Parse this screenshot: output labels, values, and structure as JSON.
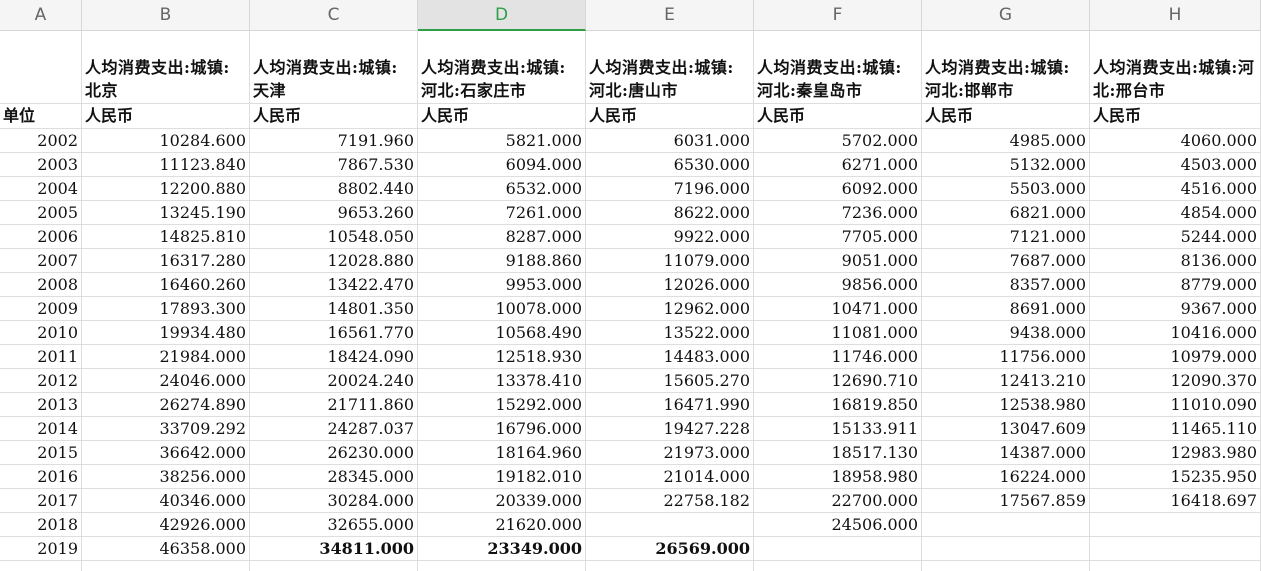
{
  "columns": [
    "A",
    "B",
    "C",
    "D",
    "E",
    "F",
    "G",
    "H"
  ],
  "selected_column": "D",
  "headers": [
    "",
    "人均消费支出:城镇:北京",
    "人均消费支出:城镇:天津",
    "人均消费支出:城镇:河北:石家庄市",
    "人均消费支出:城镇:河北:唐山市",
    "人均消费支出:城镇:河北:秦皇岛市",
    "人均消费支出:城镇:河北:邯郸市",
    "人均消费支出:城镇:河北:邢台市"
  ],
  "units": [
    "单位",
    "人民币",
    "人民币",
    "人民币",
    "人民币",
    "人民币",
    "人民币",
    "人民币"
  ],
  "rows": [
    [
      "2002",
      "10284.600",
      "7191.960",
      "5821.000",
      "6031.000",
      "5702.000",
      "4985.000",
      "4060.000"
    ],
    [
      "2003",
      "11123.840",
      "7867.530",
      "6094.000",
      "6530.000",
      "6271.000",
      "5132.000",
      "4503.000"
    ],
    [
      "2004",
      "12200.880",
      "8802.440",
      "6532.000",
      "7196.000",
      "6092.000",
      "5503.000",
      "4516.000"
    ],
    [
      "2005",
      "13245.190",
      "9653.260",
      "7261.000",
      "8622.000",
      "7236.000",
      "6821.000",
      "4854.000"
    ],
    [
      "2006",
      "14825.810",
      "10548.050",
      "8287.000",
      "9922.000",
      "7705.000",
      "7121.000",
      "5244.000"
    ],
    [
      "2007",
      "16317.280",
      "12028.880",
      "9188.860",
      "11079.000",
      "9051.000",
      "7687.000",
      "8136.000"
    ],
    [
      "2008",
      "16460.260",
      "13422.470",
      "9953.000",
      "12026.000",
      "9856.000",
      "8357.000",
      "8779.000"
    ],
    [
      "2009",
      "17893.300",
      "14801.350",
      "10078.000",
      "12962.000",
      "10471.000",
      "8691.000",
      "9367.000"
    ],
    [
      "2010",
      "19934.480",
      "16561.770",
      "10568.490",
      "13522.000",
      "11081.000",
      "9438.000",
      "10416.000"
    ],
    [
      "2011",
      "21984.000",
      "18424.090",
      "12518.930",
      "14483.000",
      "11746.000",
      "11756.000",
      "10979.000"
    ],
    [
      "2012",
      "24046.000",
      "20024.240",
      "13378.410",
      "15605.270",
      "12690.710",
      "12413.210",
      "12090.370"
    ],
    [
      "2013",
      "26274.890",
      "21711.860",
      "15292.000",
      "16471.990",
      "16819.850",
      "12538.980",
      "11010.090"
    ],
    [
      "2014",
      "33709.292",
      "24287.037",
      "16796.000",
      "19427.228",
      "15133.911",
      "13047.609",
      "11465.110"
    ],
    [
      "2015",
      "36642.000",
      "26230.000",
      "18164.960",
      "21973.000",
      "18517.130",
      "14387.000",
      "12983.980"
    ],
    [
      "2016",
      "38256.000",
      "28345.000",
      "19182.010",
      "21014.000",
      "18958.980",
      "16224.000",
      "15235.950"
    ],
    [
      "2017",
      "40346.000",
      "30284.000",
      "20339.000",
      "22758.182",
      "22700.000",
      "17567.859",
      "16418.697"
    ],
    [
      "2018",
      "42926.000",
      "32655.000",
      "21620.000",
      "",
      "24506.000",
      "",
      ""
    ],
    [
      "2019",
      "46358.000",
      "34811.000",
      "23349.000",
      "26569.000",
      "",
      "",
      ""
    ]
  ]
}
